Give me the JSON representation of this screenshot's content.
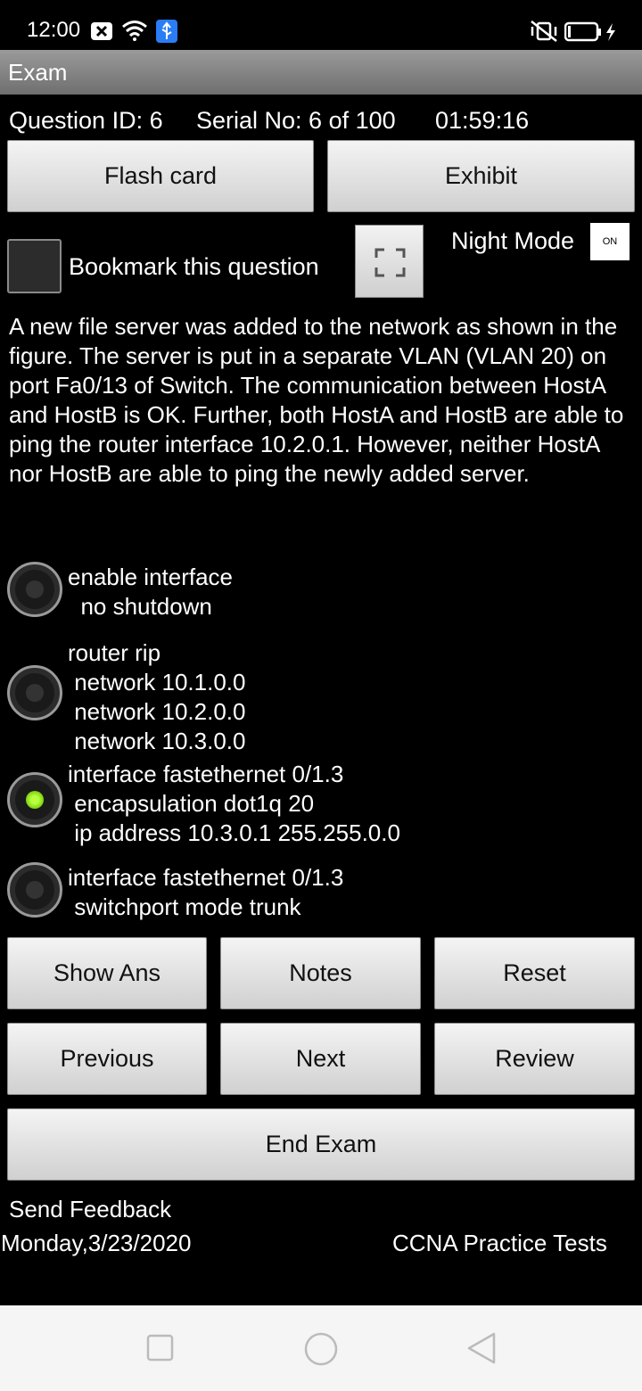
{
  "status_bar": {
    "time": "12:00"
  },
  "app_bar": {
    "title": "Exam"
  },
  "info": {
    "question_id": "Question ID: 6",
    "serial": "Serial No: 6 of 100",
    "timer": "01:59:16"
  },
  "buttons": {
    "flash_card": "Flash card",
    "exhibit": "Exhibit",
    "show_ans": "Show Ans",
    "notes": "Notes",
    "reset": "Reset",
    "previous": "Previous",
    "next": "Next",
    "review": "Review",
    "end_exam": "End Exam"
  },
  "bookmark": {
    "label": "Bookmark this question",
    "checked": false
  },
  "night_mode": {
    "label": "Night Mode",
    "toggle": "ON"
  },
  "question": {
    "text": "A new file server was added to the network as shown in the figure. The server is put in a separate VLAN (VLAN 20) on port Fa0/13 of Switch. The communication between HostA and HostB is OK. Further, both HostA and HostB are able to ping the router interface 10.2.0.1. However, neither HostA nor HostB are able to ping the newly added server."
  },
  "options": [
    {
      "text": "enable interface\n  no shutdown",
      "selected": false
    },
    {
      "text": "router rip\n network 10.1.0.0\n network 10.2.0.0\n network 10.3.0.0",
      "selected": false
    },
    {
      "text": "interface fastethernet 0/1.3\n encapsulation dot1q 20\n ip address 10.3.0.1 255.255.0.0",
      "selected": true
    },
    {
      "text": "interface fastethernet 0/1.3\n switchport mode trunk",
      "selected": false
    }
  ],
  "footer": {
    "feedback": "Send Feedback",
    "date": "Monday,3/23/2020",
    "app_name": "CCNA Practice Tests"
  },
  "colors": {
    "accent_selected": "#8ee31c",
    "button_bg": "#e0e0e0"
  }
}
